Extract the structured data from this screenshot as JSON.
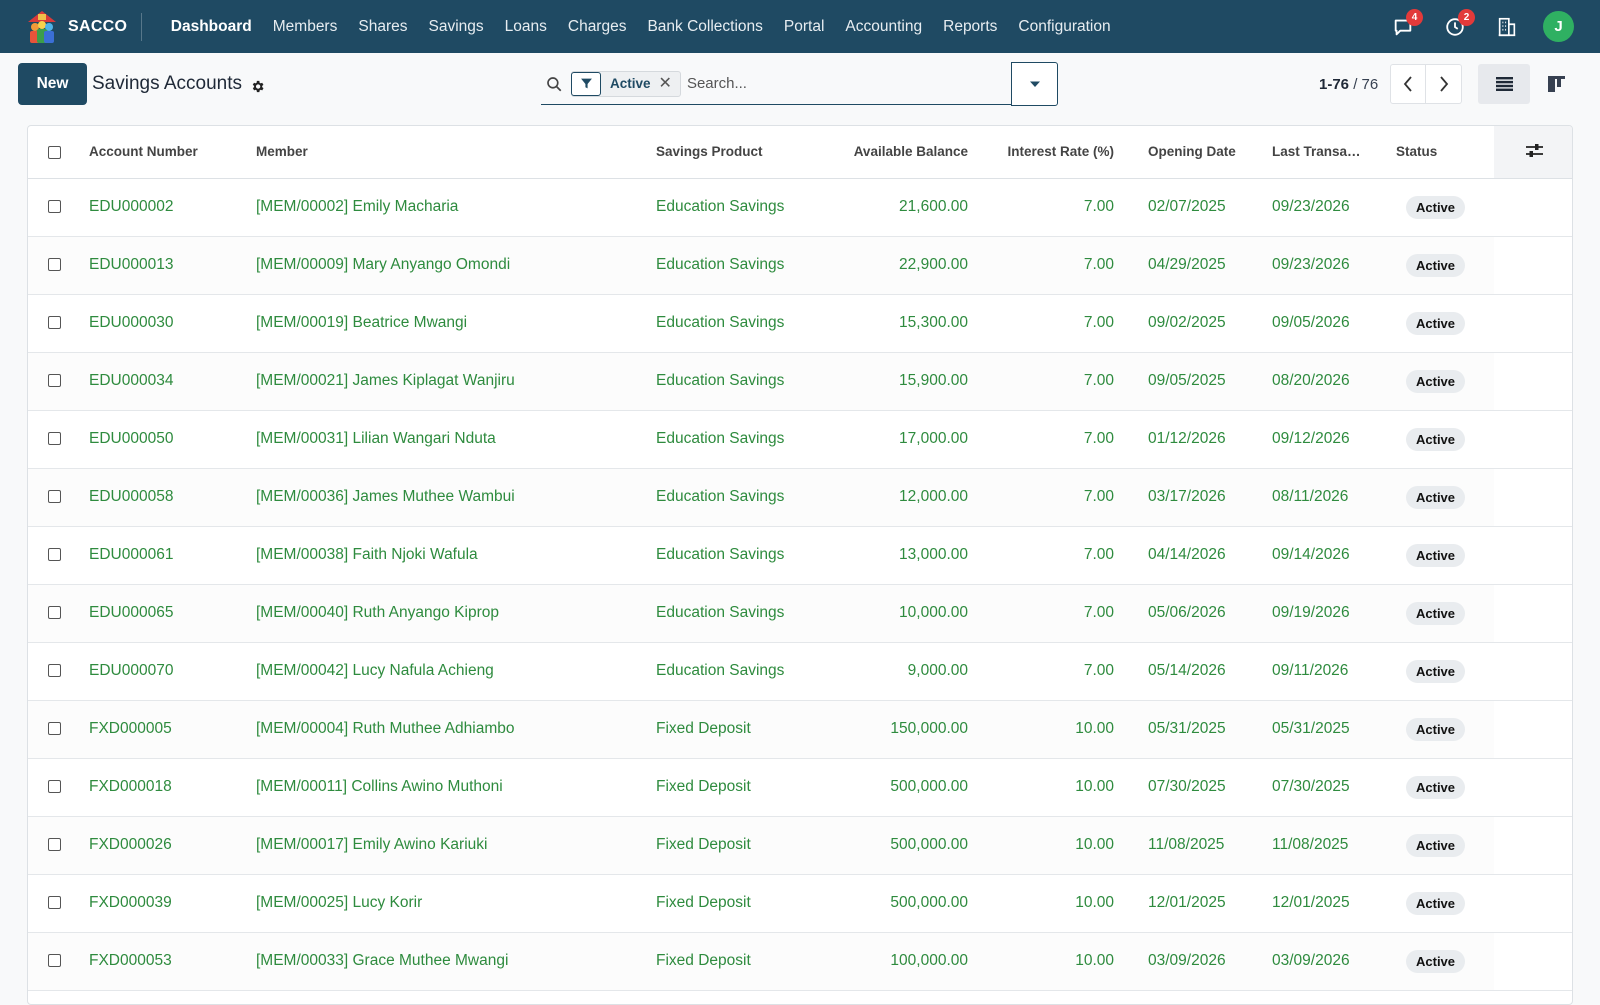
{
  "navbar": {
    "brand": "SACCO",
    "menu": [
      "Dashboard",
      "Members",
      "Shares",
      "Savings",
      "Loans",
      "Charges",
      "Bank Collections",
      "Portal",
      "Accounting",
      "Reports",
      "Configuration"
    ],
    "active_menu": "Dashboard",
    "messages_count": "4",
    "activities_count": "2",
    "user_initial": "J"
  },
  "control": {
    "new_label": "New",
    "title": "Savings Accounts",
    "facet_value": "Active",
    "facet_remove": "✕",
    "search_placeholder": "Search...",
    "pager_range": "1-76",
    "pager_sep": " / ",
    "pager_total": "76"
  },
  "table": {
    "columns": [
      "Account Number",
      "Member",
      "Savings Product",
      "Available Balance",
      "Interest Rate (%)",
      "Opening Date",
      "Last Transac...",
      "Status"
    ],
    "rows": [
      {
        "account": "EDU000002",
        "member": "[MEM/00002] Emily Macharia",
        "product": "Education Savings",
        "balance": "21,600.00",
        "rate": "7.00",
        "opened": "02/07/2025",
        "last": "09/23/2026",
        "status": "Active"
      },
      {
        "account": "EDU000013",
        "member": "[MEM/00009] Mary Anyango Omondi",
        "product": "Education Savings",
        "balance": "22,900.00",
        "rate": "7.00",
        "opened": "04/29/2025",
        "last": "09/23/2026",
        "status": "Active"
      },
      {
        "account": "EDU000030",
        "member": "[MEM/00019] Beatrice Mwangi",
        "product": "Education Savings",
        "balance": "15,300.00",
        "rate": "7.00",
        "opened": "09/02/2025",
        "last": "09/05/2026",
        "status": "Active"
      },
      {
        "account": "EDU000034",
        "member": "[MEM/00021] James Kiplagat Wanjiru",
        "product": "Education Savings",
        "balance": "15,900.00",
        "rate": "7.00",
        "opened": "09/05/2025",
        "last": "08/20/2026",
        "status": "Active"
      },
      {
        "account": "EDU000050",
        "member": "[MEM/00031] Lilian Wangari Nduta",
        "product": "Education Savings",
        "balance": "17,000.00",
        "rate": "7.00",
        "opened": "01/12/2026",
        "last": "09/12/2026",
        "status": "Active"
      },
      {
        "account": "EDU000058",
        "member": "[MEM/00036] James Muthee Wambui",
        "product": "Education Savings",
        "balance": "12,000.00",
        "rate": "7.00",
        "opened": "03/17/2026",
        "last": "08/11/2026",
        "status": "Active"
      },
      {
        "account": "EDU000061",
        "member": "[MEM/00038] Faith Njoki Wafula",
        "product": "Education Savings",
        "balance": "13,000.00",
        "rate": "7.00",
        "opened": "04/14/2026",
        "last": "09/14/2026",
        "status": "Active"
      },
      {
        "account": "EDU000065",
        "member": "[MEM/00040] Ruth Anyango Kiprop",
        "product": "Education Savings",
        "balance": "10,000.00",
        "rate": "7.00",
        "opened": "05/06/2026",
        "last": "09/19/2026",
        "status": "Active"
      },
      {
        "account": "EDU000070",
        "member": "[MEM/00042] Lucy Nafula Achieng",
        "product": "Education Savings",
        "balance": "9,000.00",
        "rate": "7.00",
        "opened": "05/14/2026",
        "last": "09/11/2026",
        "status": "Active"
      },
      {
        "account": "FXD000005",
        "member": "[MEM/00004] Ruth Muthee Adhiambo",
        "product": "Fixed Deposit",
        "balance": "150,000.00",
        "rate": "10.00",
        "opened": "05/31/2025",
        "last": "05/31/2025",
        "status": "Active"
      },
      {
        "account": "FXD000018",
        "member": "[MEM/00011] Collins Awino Muthoni",
        "product": "Fixed Deposit",
        "balance": "500,000.00",
        "rate": "10.00",
        "opened": "07/30/2025",
        "last": "07/30/2025",
        "status": "Active"
      },
      {
        "account": "FXD000026",
        "member": "[MEM/00017] Emily Awino Kariuki",
        "product": "Fixed Deposit",
        "balance": "500,000.00",
        "rate": "10.00",
        "opened": "11/08/2025",
        "last": "11/08/2025",
        "status": "Active"
      },
      {
        "account": "FXD000039",
        "member": "[MEM/00025] Lucy Korir",
        "product": "Fixed Deposit",
        "balance": "500,000.00",
        "rate": "10.00",
        "opened": "12/01/2025",
        "last": "12/01/2025",
        "status": "Active"
      },
      {
        "account": "FXD000053",
        "member": "[MEM/00033] Grace Muthee Mwangi",
        "product": "Fixed Deposit",
        "balance": "100,000.00",
        "rate": "10.00",
        "opened": "03/09/2026",
        "last": "03/09/2026",
        "status": "Active"
      }
    ]
  },
  "colors": {
    "navbar": "#1f4a63",
    "link_green": "#2e8b3e",
    "badge_red": "#e23a3a",
    "avatar_green": "#2fb062"
  },
  "icons": [
    "app-logo-icon",
    "chat-icon",
    "clock-icon",
    "building-icon",
    "gear-icon",
    "search-icon",
    "filter-icon",
    "caret-down-icon",
    "chevron-left-icon",
    "chevron-right-icon",
    "list-view-icon",
    "kanban-view-icon",
    "column-options-icon"
  ]
}
